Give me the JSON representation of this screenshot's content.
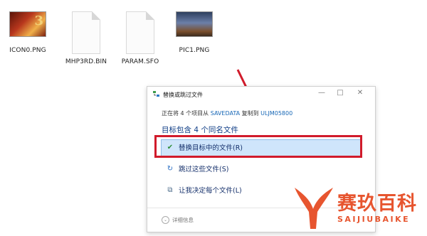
{
  "files": [
    {
      "name": "ICON0.PNG",
      "kind": "image-icon0"
    },
    {
      "name": "MHP3RD.BIN",
      "kind": "document"
    },
    {
      "name": "PARAM.SFO",
      "kind": "document"
    },
    {
      "name": "PIC1.PNG",
      "kind": "image-pic1"
    }
  ],
  "dialog": {
    "title": "替换或跳过文件",
    "subline": {
      "prefix": "正在将 4 个项目从",
      "source": "SAVEDATA",
      "middle": "复制到",
      "destination": "ULJM05800"
    },
    "headline": "目标包含 4 个同名文件",
    "options": [
      {
        "label": "替换目标中的文件(R)",
        "icon": "check-icon"
      },
      {
        "label": "跳过这些文件(S)",
        "icon": "skip-icon"
      },
      {
        "label": "让我决定每个文件(L)",
        "icon": "decide-icon"
      }
    ],
    "details_label": "详细信息"
  },
  "watermark": {
    "main": "赛玖百科",
    "sub": "SAIJIUBAIKE"
  },
  "colors": {
    "highlight_border": "#d11b2b",
    "arrow": "#d11b2b",
    "selected_option_bg": "#cfe5fb",
    "link": "#1767b6",
    "brand": "#e7552f"
  }
}
